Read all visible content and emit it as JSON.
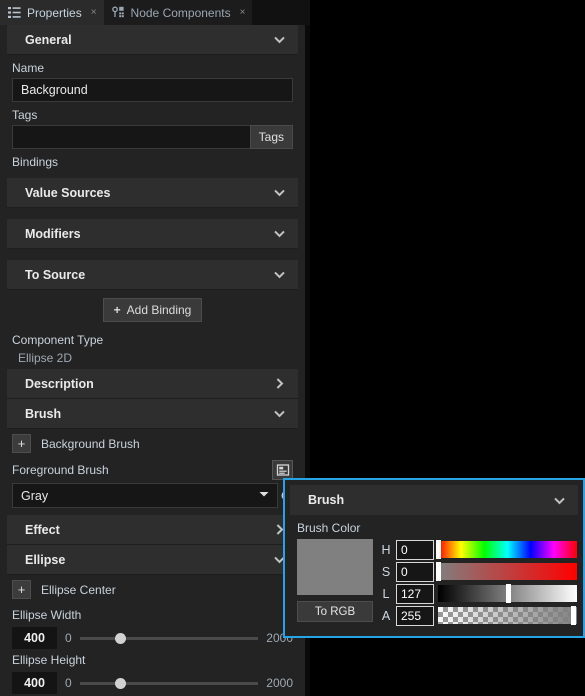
{
  "tabs": [
    {
      "label": "Properties",
      "icon": "list-icon",
      "close": "×",
      "active": true
    },
    {
      "label": "Node Components",
      "icon": "node-graph-icon",
      "close": "×",
      "active": false
    }
  ],
  "panel": {
    "general": {
      "title": "General"
    },
    "name": {
      "label": "Name",
      "value": "Background"
    },
    "tags": {
      "label": "Tags",
      "value": "",
      "button": "Tags"
    },
    "bindings": {
      "label": "Bindings",
      "sections": [
        {
          "title": "Value Sources"
        },
        {
          "title": "Modifiers"
        },
        {
          "title": "To Source"
        }
      ],
      "add_button": "Add Binding",
      "add_plus": "+"
    },
    "component_type": {
      "label": "Component Type",
      "value": "Ellipse 2D"
    },
    "description": {
      "title": "Description"
    },
    "brush": {
      "title": "Brush",
      "background_brush": {
        "plus": "+",
        "label": "Background Brush"
      },
      "foreground_brush": {
        "label": "Foreground Brush",
        "value": "Gray",
        "icon": "form-panel-icon"
      }
    },
    "effect": {
      "title": "Effect"
    },
    "ellipse": {
      "title": "Ellipse",
      "center": {
        "plus": "+",
        "label": "Ellipse Center"
      },
      "width": {
        "label": "Ellipse Width",
        "value": "400",
        "min": "0",
        "max": "2000",
        "percent": 20
      },
      "height": {
        "label": "Ellipse Height",
        "value": "400",
        "min": "0",
        "max": "2000",
        "percent": 20
      }
    }
  },
  "popup": {
    "title": "Brush",
    "subtitle": "Brush Color",
    "swatch_color": "#808080",
    "to_rgb": "To RGB",
    "channels": [
      {
        "letter": "H",
        "value": "0",
        "percent": 0
      },
      {
        "letter": "S",
        "value": "0",
        "percent": 0
      },
      {
        "letter": "L",
        "value": "127",
        "percent": 50
      },
      {
        "letter": "A",
        "value": "255",
        "percent": 97
      }
    ],
    "accent": "#27a4e6"
  }
}
